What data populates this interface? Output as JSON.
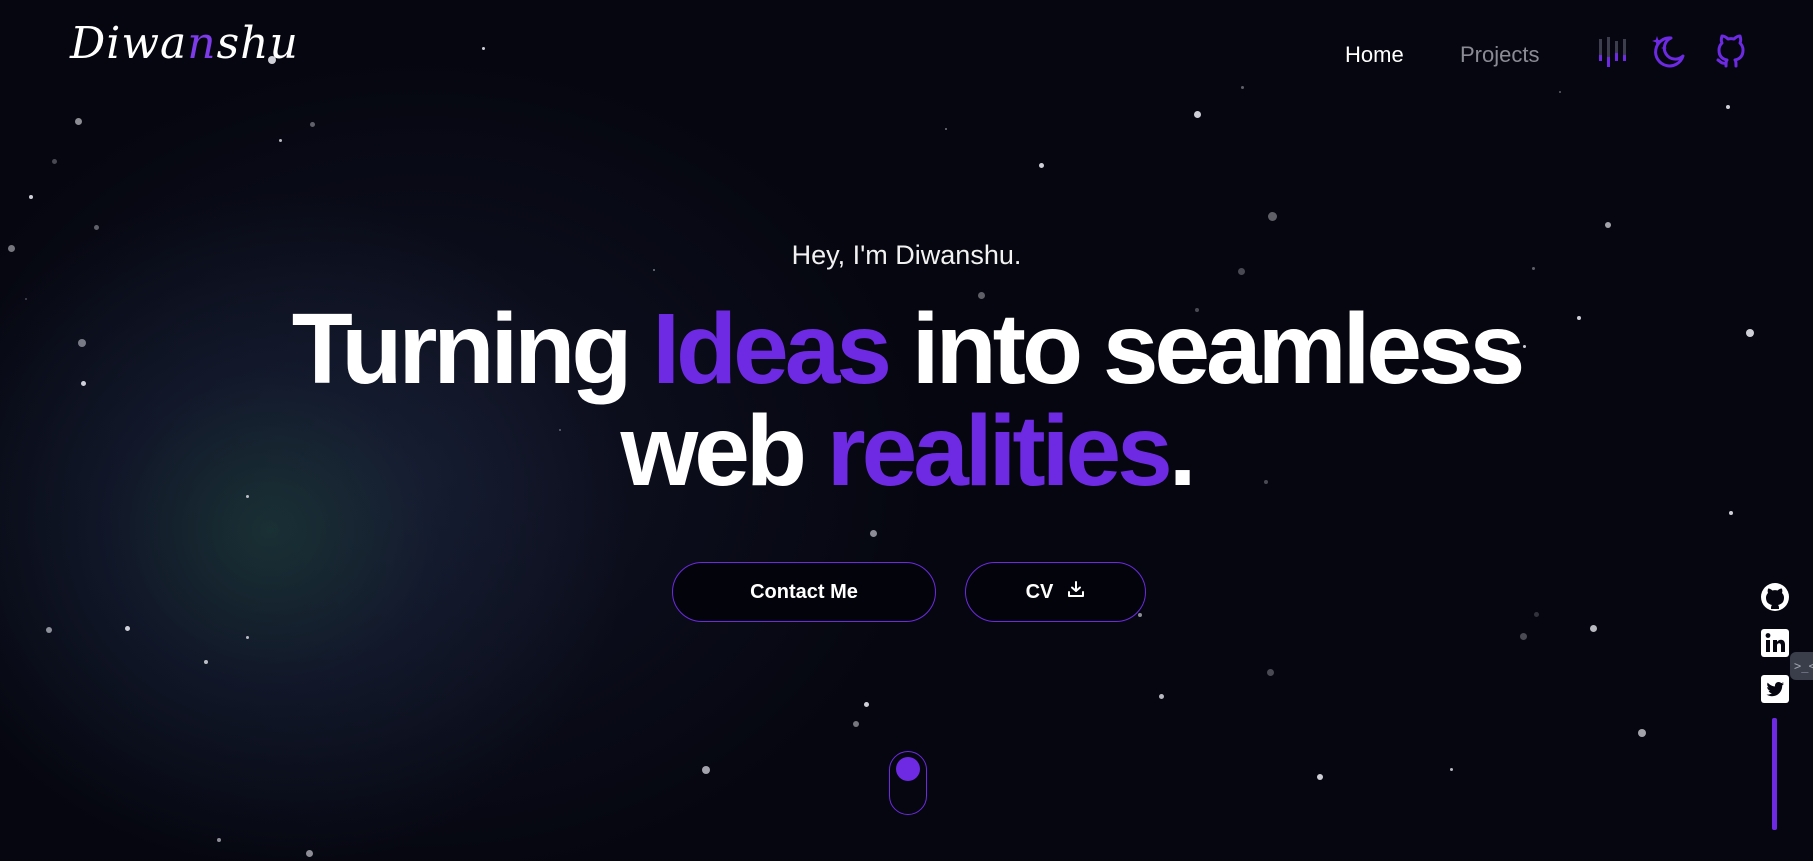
{
  "header": {
    "logo_parts": [
      "Diwa",
      "n",
      "shu"
    ],
    "nav": [
      {
        "label": "Home",
        "active": true
      },
      {
        "label": "Projects",
        "active": false
      }
    ],
    "icons": [
      "sound-bars-icon",
      "moon-stars-icon",
      "github-icon"
    ]
  },
  "hero": {
    "greeting": "Hey, I'm Diwanshu.",
    "headline": {
      "w1": "Turning",
      "w2": "Ideas",
      "w3": "into seamless",
      "w4": "web",
      "w5": "realities",
      "w6": "."
    },
    "buttons": {
      "contact": "Contact Me",
      "cv": "CV"
    }
  },
  "social_rail": {
    "icons": [
      "github-icon",
      "linkedin-icon",
      "twitter-icon"
    ],
    "terminal_tab": ">_<"
  },
  "colors": {
    "background": "#05060f",
    "accent": "#6d2ae2",
    "muted_nav": "#8b8b96"
  }
}
